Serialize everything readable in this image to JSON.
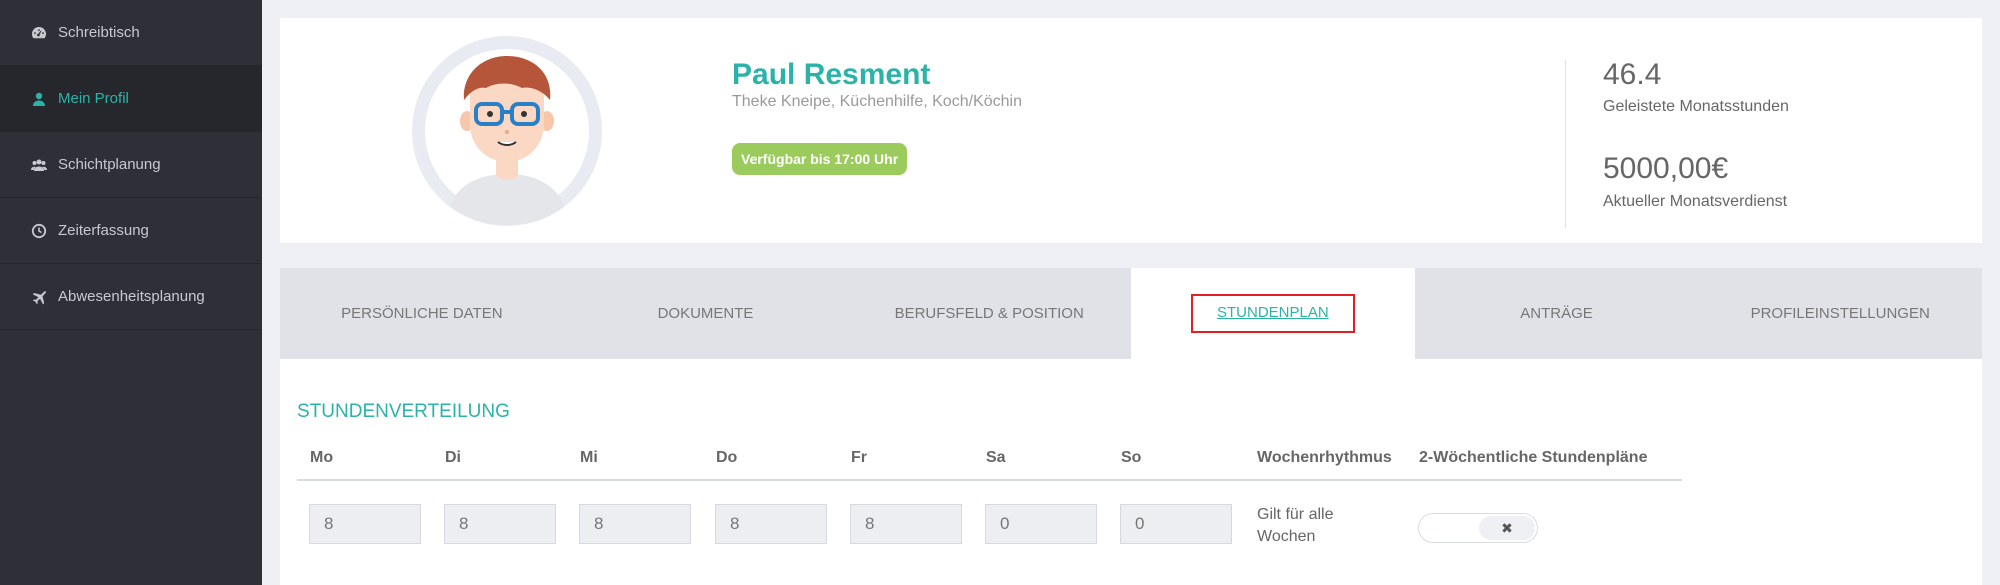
{
  "sidebar": {
    "items": [
      {
        "label": "Schreibtisch",
        "icon": "dashboard-icon",
        "active": false
      },
      {
        "label": "Mein Profil",
        "icon": "user-icon",
        "active": true
      },
      {
        "label": "Schichtplanung",
        "icon": "users-icon",
        "active": false
      },
      {
        "label": "Zeiterfassung",
        "icon": "clock-icon",
        "active": false
      },
      {
        "label": "Abwesenheitsplanung",
        "icon": "plane-icon",
        "active": false
      }
    ]
  },
  "profile": {
    "name": "Paul Resment",
    "roles": "Theke Kneipe, Küchenhilfe, Koch/Köchin",
    "availability": "Verfügbar bis 17:00 Uhr",
    "stats": [
      {
        "value": "46.4",
        "label": "Geleistete Monatsstunden"
      },
      {
        "value": "5000,00€",
        "label": "Aktueller Monatsverdienst"
      }
    ]
  },
  "tabs": [
    {
      "label": "PERSÖNLICHE DATEN",
      "active": false
    },
    {
      "label": "DOKUMENTE",
      "active": false
    },
    {
      "label": "BERUFSFELD & POSITION",
      "active": false
    },
    {
      "label": "STUNDENPLAN",
      "active": true
    },
    {
      "label": "ANTRÄGE",
      "active": false
    },
    {
      "label": "PROFILEINSTELLUNGEN",
      "active": false
    }
  ],
  "schedule": {
    "title": "STUNDENVERTEILUNG",
    "days": [
      "Mo",
      "Di",
      "Mi",
      "Do",
      "Fr",
      "Sa",
      "So"
    ],
    "hours": [
      "8",
      "8",
      "8",
      "8",
      "8",
      "0",
      "0"
    ],
    "rhythm_header": "Wochenrhythmus",
    "biweekly_header": "2-Wöchentliche Stundenpläne",
    "rhythm_value": "Gilt für alle Wochen",
    "toggle_symbol": "✖"
  },
  "colors": {
    "accent": "#2bb3a8",
    "sidebar_bg": "#2f3037",
    "badge_bg": "#9acb5c",
    "highlight_border": "#e01f27"
  }
}
